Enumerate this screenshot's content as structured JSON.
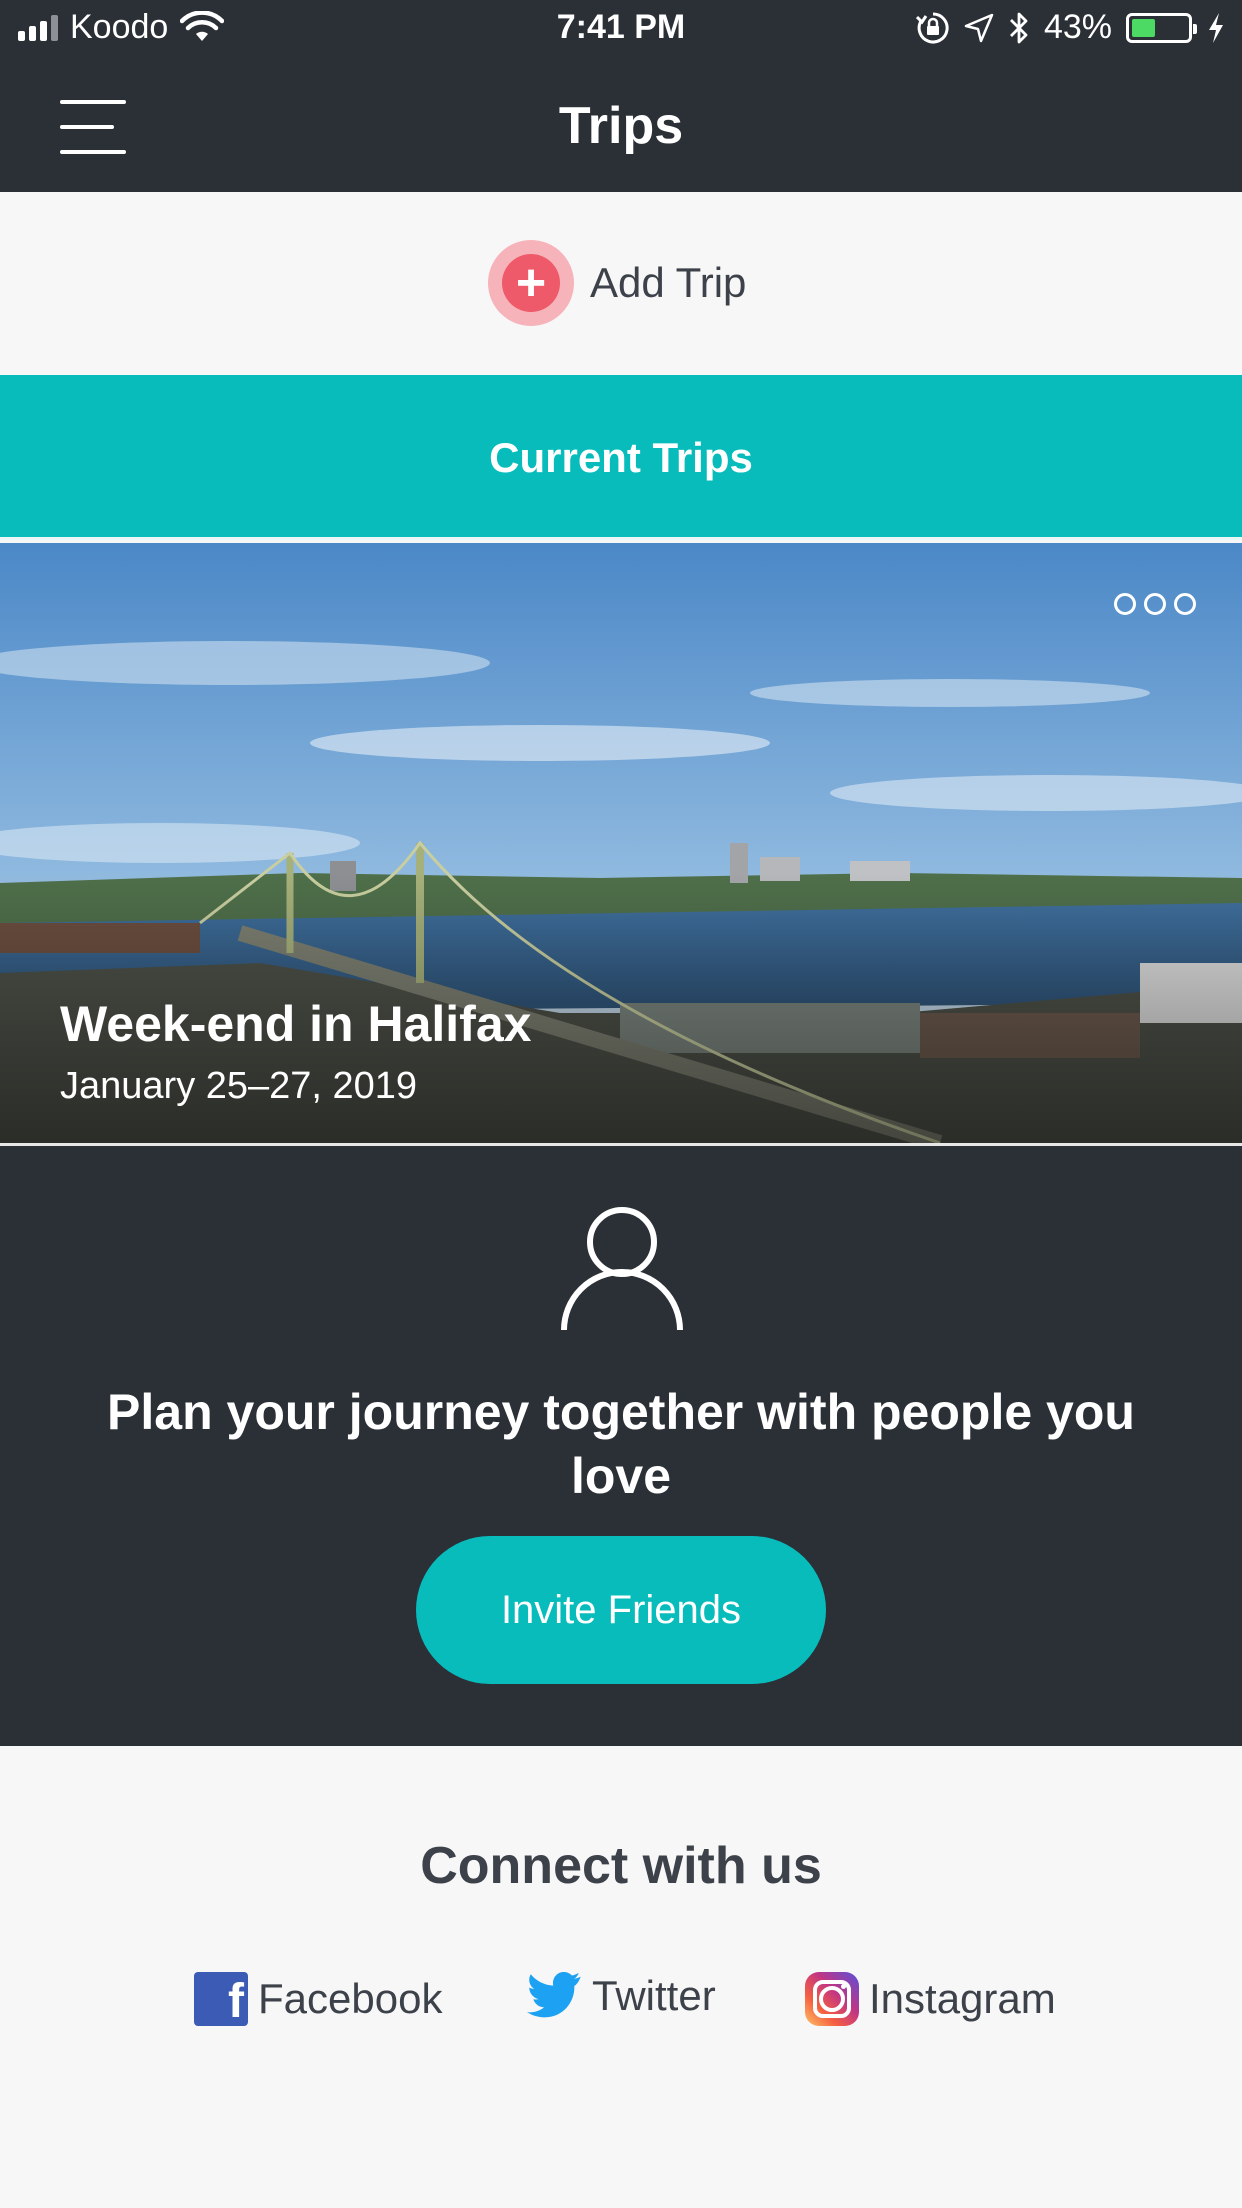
{
  "status_bar": {
    "carrier": "Koodo",
    "time": "7:41 PM",
    "battery_percent": "43%",
    "battery_level": 0.43,
    "icons": [
      "signal-icon",
      "wifi-icon",
      "orientation-lock-icon",
      "location-icon",
      "bluetooth-icon",
      "battery-icon",
      "charging-icon"
    ]
  },
  "navbar": {
    "title": "Trips",
    "menu_icon": "hamburger-menu-icon"
  },
  "add_trip": {
    "label": "Add Trip",
    "icon": "plus-icon"
  },
  "current_trips": {
    "header": "Current Trips",
    "trips": [
      {
        "title": "Week-end in Halifax",
        "dates": "January 25–27, 2019",
        "more_icon": "more-options-icon"
      }
    ]
  },
  "invite": {
    "icon": "person-icon",
    "message": "Plan your journey together with people you love",
    "button_label": "Invite Friends"
  },
  "connect": {
    "title": "Connect with us",
    "links": [
      {
        "label": "Facebook",
        "icon": "facebook-icon"
      },
      {
        "label": "Twitter",
        "icon": "twitter-icon"
      },
      {
        "label": "Instagram",
        "icon": "instagram-icon"
      }
    ]
  },
  "colors": {
    "dark_bg": "#2b2f36",
    "teal_accent": "#08bcbc",
    "add_trip_red": "#ee5a6a",
    "light_bg": "#f7f7f7",
    "text_dark": "#3c414a"
  }
}
